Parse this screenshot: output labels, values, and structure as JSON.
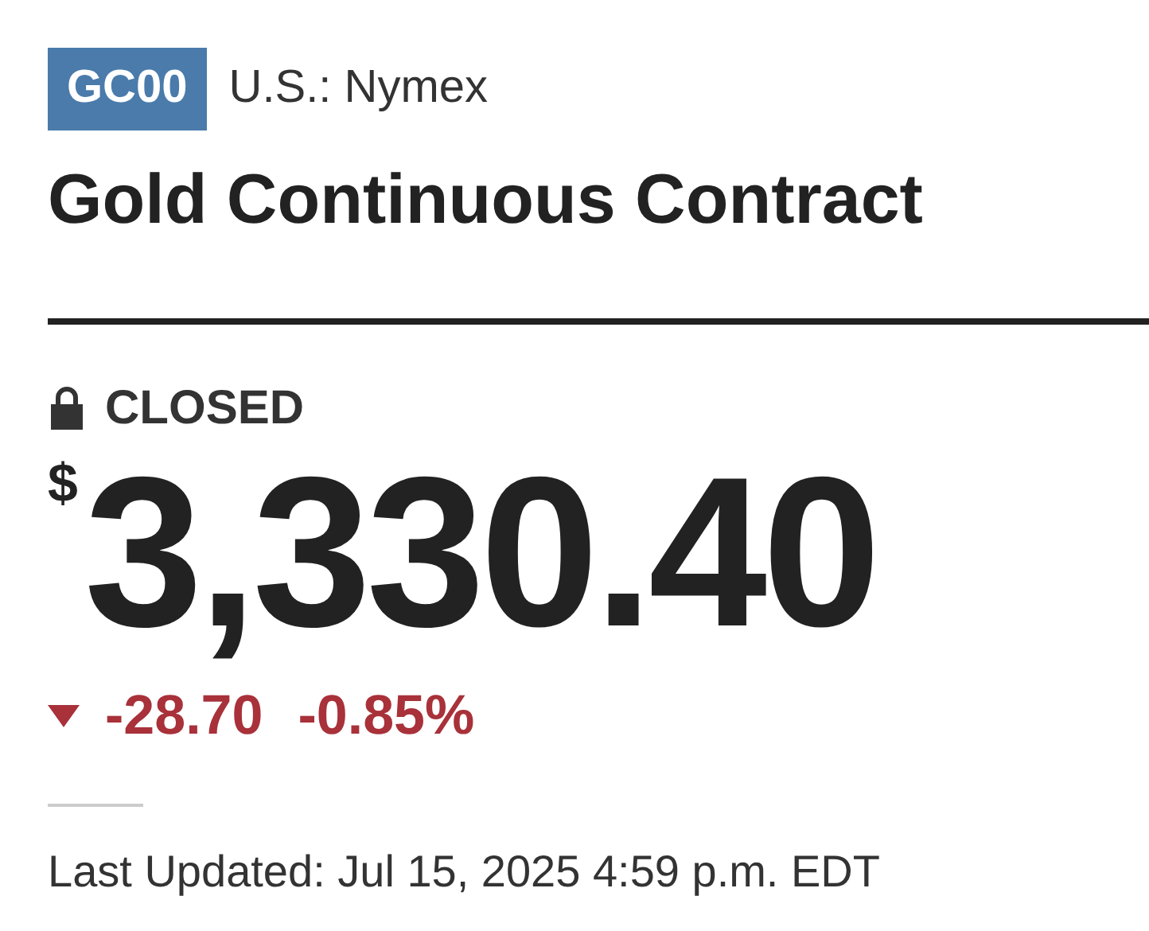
{
  "ticker": {
    "symbol": "GC00",
    "exchange": "U.S.: Nymex"
  },
  "title": "Gold Continuous Contract",
  "market_status": {
    "label": "CLOSED",
    "locked": true
  },
  "quote": {
    "currency": "$",
    "price": "3,330.40",
    "falling": true,
    "change": "-28.70",
    "change_percent": "-0.85%"
  },
  "last_updated": "Last Updated: Jul 15, 2025 4:59 p.m. EDT"
}
